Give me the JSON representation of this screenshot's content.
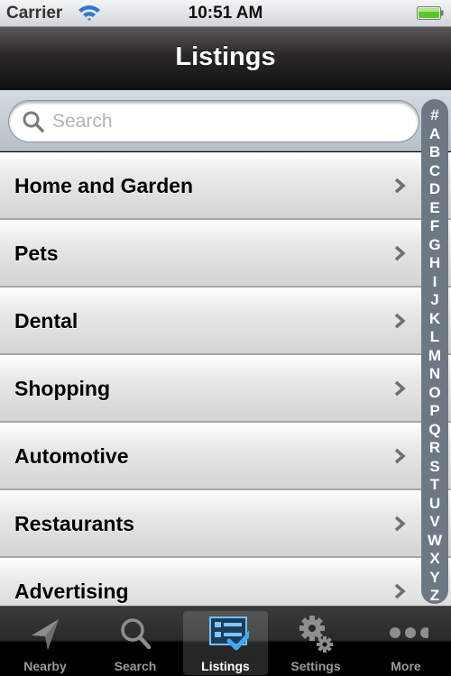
{
  "status_bar": {
    "carrier": "Carrier",
    "time": "10:51 AM",
    "wifi_icon": "wifi-icon",
    "battery_icon": "battery-full-icon",
    "battery_color": "#5ac62d"
  },
  "nav_bar": {
    "title": "Listings"
  },
  "search": {
    "placeholder": "Search",
    "value": "",
    "icon": "search-icon"
  },
  "listings": [
    {
      "label": "Home and Garden"
    },
    {
      "label": "Pets"
    },
    {
      "label": "Dental"
    },
    {
      "label": "Shopping"
    },
    {
      "label": "Automotive"
    },
    {
      "label": "Restaurants"
    },
    {
      "label": "Advertising"
    }
  ],
  "section_index": [
    "#",
    "A",
    "B",
    "C",
    "D",
    "E",
    "F",
    "G",
    "H",
    "I",
    "J",
    "K",
    "L",
    "M",
    "N",
    "O",
    "P",
    "Q",
    "R",
    "S",
    "T",
    "U",
    "V",
    "W",
    "X",
    "Y",
    "Z"
  ],
  "tab_bar": {
    "active": "Listings",
    "accent_color": "#3fa9f5",
    "tabs": [
      {
        "label": "Nearby",
        "icon": "location-arrow-icon"
      },
      {
        "label": "Search",
        "icon": "search-icon"
      },
      {
        "label": "Listings",
        "icon": "checklist-icon"
      },
      {
        "label": "Settings",
        "icon": "gears-icon"
      },
      {
        "label": "More",
        "icon": "more-dots-icon"
      }
    ]
  }
}
